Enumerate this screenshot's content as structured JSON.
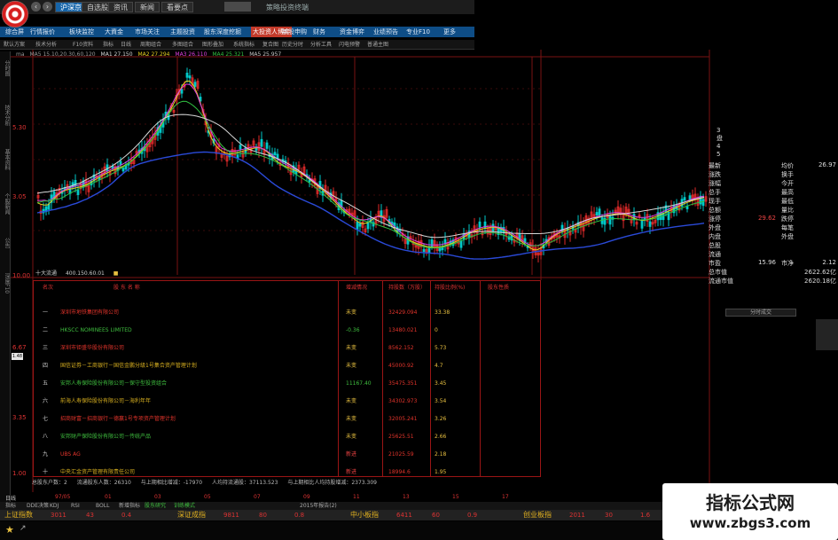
{
  "titlebar": {
    "tabs": [
      "沪深京",
      "自选股",
      "资讯",
      "新闻",
      "看要点"
    ],
    "active_tab": "沪深京",
    "app_title": "策略投资终端",
    "nav_back": "‹",
    "nav_forward": "›"
  },
  "menubar": {
    "items": [
      "综合屏",
      "行情报价",
      "板块监控",
      "大資金",
      "市场关注",
      "主题投资",
      "股东深度挖掘",
      "大投资人博弈",
      "新股申购",
      "财务",
      "资金博弈",
      "业绩预告",
      "专业F10",
      "更多"
    ],
    "highlight": "大投资人博弈"
  },
  "toolbar": {
    "items": [
      "默认方案",
      "技术分析",
      "F10资料",
      "指标",
      "日线",
      "周期组合",
      "多图组合",
      "图形叠加",
      "系统指标",
      "复合图",
      "历史分时",
      "分析工具",
      "闪电预警",
      "普通主图"
    ]
  },
  "chart": {
    "legend": [
      "ma",
      "MA5 15.10,20.30,60,120",
      "MA1 27.150",
      "MA2 27.294",
      "MA3 26.110",
      "MA4 25.321",
      "MA5 25.957"
    ],
    "price_labels": [
      "5.30",
      "3.05",
      "10.00",
      "6.67",
      "3.35",
      "1.00"
    ],
    "scale_mark": "1.48",
    "ten_holders_marker": [
      "十大流通",
      "400.150.60.01",
      "■"
    ],
    "colors": {
      "candle_up": "#e02a2a",
      "candle_down": "#00c8c8",
      "ma1": "#d8d8d8",
      "ma2": "#e8d020",
      "ma3": "#e040e0",
      "ma4": "#30c040",
      "ma5": "#c8c8c8",
      "ma6": "#2a4ad8"
    }
  },
  "sidebar": {
    "items": [
      "分时图",
      "技术分析",
      "基本资料",
      "个股新闻",
      "公告",
      "深度F10"
    ]
  },
  "shareholders": {
    "headers": [
      "名次",
      "股 东 名 称",
      "增减情况",
      "持股数（万股）",
      "持股比例(%)",
      "股东性质"
    ],
    "rows": [
      {
        "rank": "一",
        "name": "深圳市地铁集团有限公司",
        "change": "未变",
        "shares": "32429.094",
        "pct": "33.38"
      },
      {
        "rank": "二",
        "name": "HKSCC NOMINEES LIMITED",
        "change": "-0.36",
        "shares": "13480.021",
        "pct": "0"
      },
      {
        "rank": "三",
        "name": "深圳市钜盛华股份有限公司",
        "change": "未变",
        "shares": "8562.152",
        "pct": "5.73"
      },
      {
        "rank": "四",
        "name": "国信证券－工商银行－国信金鹏分级1号集合资产管理计划",
        "change": "未变",
        "shares": "45000.92",
        "pct": "4.7"
      },
      {
        "rank": "五",
        "name": "安邦人寿保险股份有限公司－保守型投资组合",
        "change": "11167.40",
        "shares": "35475.351",
        "pct": "3.45"
      },
      {
        "rank": "六",
        "name": "前海人寿保险股份有限公司－海利年年",
        "change": "未变",
        "shares": "34302.973",
        "pct": "3.54"
      },
      {
        "rank": "七",
        "name": "招商财富－招商银行－德赢1号专项资产管理计划",
        "change": "未变",
        "shares": "32005.241",
        "pct": "3.26"
      },
      {
        "rank": "八",
        "name": "安邦财产保险股份有限公司－传统产品",
        "change": "未变",
        "shares": "25625.51",
        "pct": "2.66"
      },
      {
        "rank": "九",
        "name": "UBS AG",
        "change": "新进",
        "shares": "21025.59",
        "pct": "2.18"
      },
      {
        "rank": "十",
        "name": "中央汇金资产管理有限责任公司",
        "change": "新进",
        "shares": "18994.6",
        "pct": "1.95"
      }
    ],
    "summary": [
      "总股东户数：2",
      "流通股东人数：26310",
      "与上期相比增减：-17970",
      "人均持流通股：37113.523",
      "与上期相比人均持股增减：2373.309"
    ]
  },
  "right_panel": {
    "stack": [
      "3",
      "盘",
      "4",
      "5"
    ],
    "rows": [
      {
        "l": "最新",
        "m": "",
        "r": "均价",
        "rv": "26.97"
      },
      {
        "l": "涨跌",
        "m": "",
        "r": "换手",
        "rv": ""
      },
      {
        "l": "涨幅",
        "m": "",
        "r": "今开",
        "rv": ""
      },
      {
        "l": "总手",
        "m": "",
        "r": "最高",
        "rv": ""
      },
      {
        "l": "现手",
        "m": "",
        "r": "最低",
        "rv": ""
      },
      {
        "l": "总额",
        "m": "",
        "r": "量比",
        "rv": ""
      },
      {
        "l": "涨停",
        "m": "29.62",
        "r": "跌停",
        "rv": ""
      },
      {
        "l": "外盘",
        "m": "",
        "r": "每笔",
        "rv": ""
      },
      {
        "l": "内盘",
        "m": "",
        "r": "外盘",
        "rv": ""
      },
      {
        "l": "总股",
        "m": "",
        "r": "",
        "rv": ""
      },
      {
        "l": "流通",
        "m": "",
        "r": "",
        "rv": ""
      },
      {
        "l": "市盈",
        "m": "15.96",
        "r": "市净",
        "rv": "2.12"
      },
      {
        "l": "总市值",
        "m": "",
        "r": "",
        "rv": "2622.62亿"
      },
      {
        "l": "流通市值",
        "m": "",
        "r": "",
        "rv": "2620.18亿"
      }
    ],
    "button": "分时成交"
  },
  "bottom": {
    "dates": [
      "日线",
      "97/05",
      "01",
      "03",
      "05",
      "07",
      "09",
      "11",
      "13",
      "15",
      "17"
    ],
    "tabs": [
      {
        "label": "指标",
        "green": false
      },
      {
        "label": "DDE决策",
        "green": false
      },
      {
        "label": "KDJ",
        "green": false
      },
      {
        "label": "RSI",
        "green": false
      },
      {
        "label": "BOLL",
        "green": false
      },
      {
        "label": "新增指标",
        "green": false
      },
      {
        "label": "股东研究",
        "green": true
      },
      {
        "label": "训练模式",
        "green": true
      },
      {
        "label": "2015年报告(2)",
        "green": false
      }
    ],
    "indices": [
      {
        "name": "上证指数",
        "vals": [
          "3011",
          "43",
          "0.4"
        ]
      },
      {
        "name": "深证成指",
        "vals": [
          "9811",
          "80",
          "0.8"
        ]
      },
      {
        "name": "中小板指",
        "vals": [
          "6411",
          "60",
          "0.9"
        ]
      },
      {
        "name": "创业板指",
        "vals": [
          "2011",
          "30",
          "1.6"
        ]
      }
    ]
  },
  "watermark": {
    "title": "指标公式网",
    "url": "www.zbgs3.com"
  }
}
